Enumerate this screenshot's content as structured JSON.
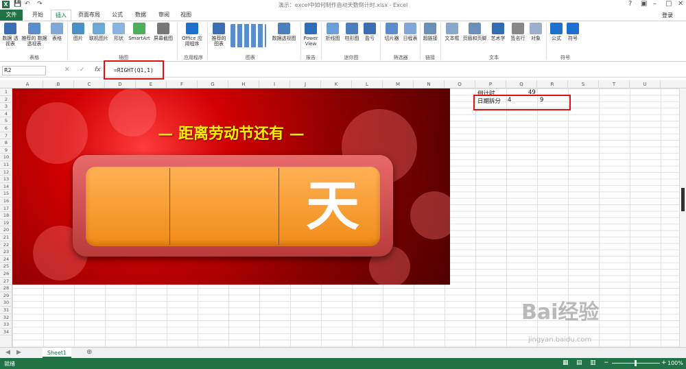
{
  "window": {
    "title": "演示：excel中如何制作自动天数倒计时.xlsx - Excel",
    "login": "登录",
    "app_icon": "X"
  },
  "tabs": [
    "文件",
    "开始",
    "插入",
    "页面布局",
    "公式",
    "数据",
    "审阅",
    "视图"
  ],
  "ribbon": {
    "buttons": [
      "数据\n透视表",
      "推荐的\n数据透视表",
      "表格",
      "图片",
      "联机图片",
      "形状",
      "SmartArt",
      "屏幕截图",
      "Office\n应用程序",
      "推荐的\n图表",
      "数据透视图",
      "Power\nView",
      "折线图",
      "柱形图",
      "盈亏",
      "切片器",
      "日程表",
      "超链接",
      "文本框",
      "页眉和页脚",
      "艺术字",
      "签名行",
      "对象",
      "公式",
      "符号"
    ],
    "groups": [
      "表格",
      "插图",
      "应用程序",
      "图表",
      "报告",
      "迷你图",
      "筛选器",
      "链接",
      "文本",
      "符号"
    ]
  },
  "formula_bar": {
    "name_box": "R2",
    "fx": "fx",
    "formula": "=RIGHT(Q1,1)"
  },
  "columns": [
    "A",
    "B",
    "C",
    "D",
    "E",
    "F",
    "G",
    "H",
    "I",
    "J",
    "K",
    "L",
    "M",
    "N",
    "O",
    "P",
    "Q",
    "R",
    "S",
    "T",
    "U"
  ],
  "rows": [
    "1",
    "2",
    "3",
    "4",
    "5",
    "6",
    "7",
    "8",
    "9",
    "10",
    "11",
    "12",
    "13",
    "14",
    "15",
    "16",
    "17",
    "18",
    "19",
    "20",
    "21",
    "22",
    "23",
    "24",
    "25",
    "26",
    "27",
    "28",
    "29",
    "30",
    "31",
    "32",
    "33",
    "34"
  ],
  "banner": {
    "title": "— 距离劳动节还有 —",
    "unit": "天"
  },
  "cells": {
    "p1": "倒计时",
    "q1": "49",
    "p2": "日期拆分",
    "q2": "4",
    "r2": "9"
  },
  "sheets": [
    "Sheet1"
  ],
  "status": {
    "ready": "就绪",
    "zoom": "100%"
  },
  "watermark": {
    "brand": "Bai经验",
    "url": "jingyan.baidu.com"
  },
  "colors": {
    "excel_green": "#217346",
    "banner_red": "#c00000",
    "title_yellow": "#ffee00",
    "panel_orange": "#f7941d",
    "highlight_red": "#e01010"
  }
}
